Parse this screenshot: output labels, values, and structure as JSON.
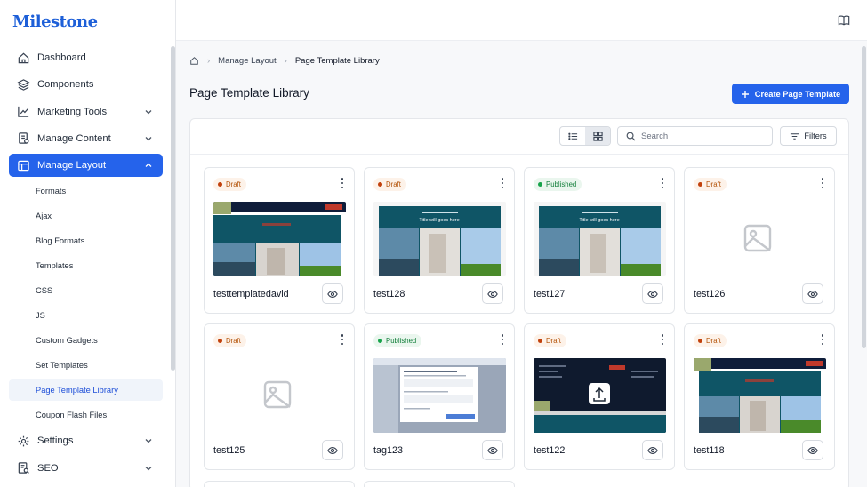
{
  "app": {
    "logo": "Milestone"
  },
  "sidebar": {
    "items": [
      {
        "label": "Dashboard",
        "icon": "home-icon"
      },
      {
        "label": "Components",
        "icon": "layers-icon"
      },
      {
        "label": "Marketing Tools",
        "icon": "trend-chart-icon"
      },
      {
        "label": "Manage Content",
        "icon": "content-icon"
      },
      {
        "label": "Manage Layout",
        "icon": "layout-icon"
      },
      {
        "label": "Settings",
        "icon": "gear-icon"
      },
      {
        "label": "SEO",
        "icon": "seo-icon"
      }
    ],
    "sub_items": [
      "Formats",
      "Ajax",
      "Blog Formats",
      "Templates",
      "CSS",
      "JS",
      "Custom Gadgets",
      "Set Templates",
      "Page Template Library",
      "Coupon Flash Files"
    ]
  },
  "breadcrumb": {
    "items": [
      "Manage Layout",
      "Page Template Library"
    ]
  },
  "header": {
    "title": "Page Template Library",
    "create_label": "Create Page Template"
  },
  "toolbar": {
    "search_placeholder": "Search",
    "filters_label": "Filters"
  },
  "cards": [
    {
      "name": "testtemplatedavid",
      "status": "Draft",
      "thumb": "site-preview-a"
    },
    {
      "name": "test128",
      "status": "Draft",
      "thumb": "site-preview-b",
      "thumb_text": "Title will goes here"
    },
    {
      "name": "test127",
      "status": "Published",
      "thumb": "site-preview-b",
      "thumb_text": "Title will goes here"
    },
    {
      "name": "test126",
      "status": "Draft",
      "thumb": "placeholder"
    },
    {
      "name": "test125",
      "status": "Draft",
      "thumb": "placeholder"
    },
    {
      "name": "tag123",
      "status": "Published",
      "thumb": "dialog-preview"
    },
    {
      "name": "test122",
      "status": "Draft",
      "thumb": "dark-upload-preview"
    },
    {
      "name": "test118",
      "status": "Draft",
      "thumb": "site-preview-a"
    }
  ],
  "colors": {
    "primary": "#2563eb",
    "draft": "#c2410c",
    "published": "#16a34a",
    "thumb_teal": "#0f5566"
  }
}
